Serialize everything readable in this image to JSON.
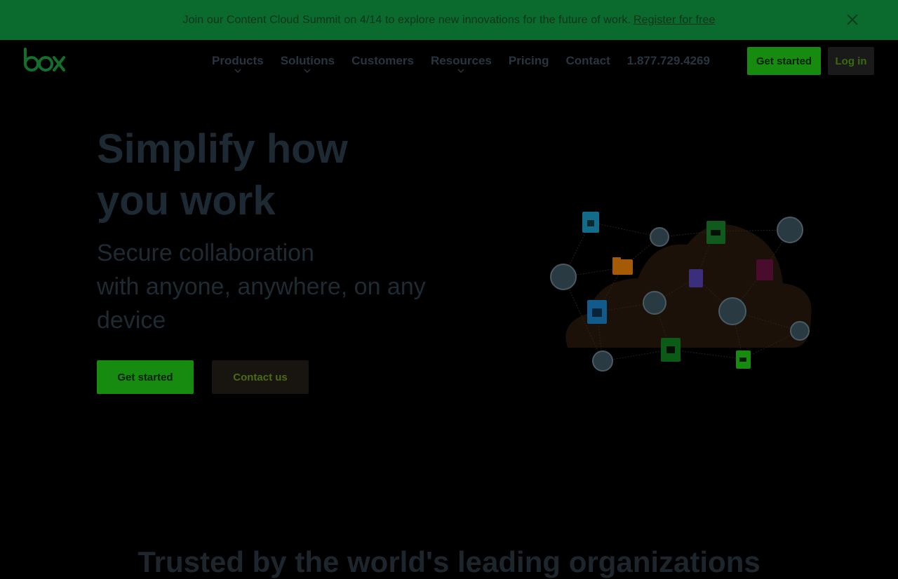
{
  "banner": {
    "text": "Join our Content Cloud Summit on 4/14 to explore new innovations for the future of work.",
    "link_label": "Register for free"
  },
  "header": {
    "logo_text": "box",
    "nav": [
      {
        "label": "Products",
        "has_dropdown": true
      },
      {
        "label": "Solutions",
        "has_dropdown": true
      },
      {
        "label": "Customers",
        "has_dropdown": false
      },
      {
        "label": "Resources",
        "has_dropdown": true
      },
      {
        "label": "Pricing",
        "has_dropdown": false
      },
      {
        "label": "Contact",
        "has_dropdown": false
      }
    ],
    "phone": "1.877.729.4269",
    "get_started_label": "Get started",
    "login_label": "Log in"
  },
  "hero": {
    "title_line1": "Simplify how",
    "title_line2": "you work",
    "subtitle_line1": "Secure collaboration",
    "subtitle_line2": "with anyone, anywhere, on any",
    "subtitle_line3": "device",
    "primary_cta": "Get started",
    "secondary_cta": "Contact us"
  },
  "trusted": {
    "heading": "Trusted by the world's leading organizations"
  },
  "colors": {
    "banner_bg": "#0b6b2e",
    "brand_green": "#178a10",
    "page_bg": "#000000"
  },
  "icons": [
    "close-icon",
    "chevron-down-icon",
    "box-logo",
    "cloud-illustration"
  ]
}
